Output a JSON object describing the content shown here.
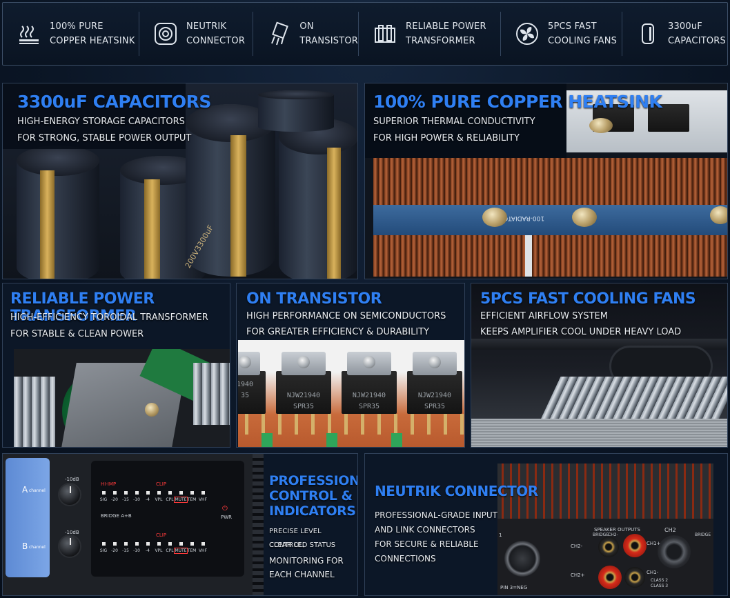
{
  "features": [
    {
      "icon": "heatsink-icon",
      "label": "100% PURE\nCOPPER HEATSINK"
    },
    {
      "icon": "neutrik-connector-icon",
      "label": "NEUTRIK\nCONNECTOR"
    },
    {
      "icon": "transistor-icon",
      "label": "ON\nTRANSISTOR"
    },
    {
      "icon": "transformer-icon",
      "label": "RELIABLE POWER\nTRANSFORMER"
    },
    {
      "icon": "fan-icon",
      "label": "5PCS FAST\nCOOLING FANS"
    },
    {
      "icon": "capacitor-icon",
      "label": "3300uF\nCAPACITORS"
    }
  ],
  "panels": {
    "capacitors": {
      "title": "3300uF CAPACITORS",
      "line1": "HIGH-ENERGY STORAGE CAPACITORS",
      "line2": "FOR STRONG, STABLE POWER OUTPUT"
    },
    "heatsink": {
      "title": "100% PURE COPPER HEATSINK",
      "line1": "SUPERIOR THERMAL CONDUCTIVITY",
      "line2": "FOR HIGH POWER & RELIABILITY"
    },
    "transformer": {
      "title": "RELIABLE POWER TRANSFORMER",
      "line1": "HIGH-EFFICIENCY TOROIDAL TRANSFORMER",
      "line2": "FOR STABLE & CLEAN POWER"
    },
    "transistor": {
      "title": "ON TRANSISTOR",
      "line1": "HIGH PERFORMANCE ON SEMICONDUCTORS",
      "line2": "FOR GREATER EFFICIENCY & DURABILITY"
    },
    "fans": {
      "title": "5PCS FAST COOLING FANS",
      "line1": "EFFICIENT AIRFLOW SYSTEM",
      "line2": "KEEPS AMPLIFIER COOL UNDER HEAVY LOAD"
    },
    "control": {
      "title_line1": "PROFESSIONAL",
      "title_line2": "CONTROL &",
      "title_line3": "INDICATORS",
      "small1": "PRECISE LEVEL CONTROL,",
      "small2": "CLEAR LED STATUS",
      "line1": "MONITORING FOR",
      "line2": "EACH CHANNEL"
    },
    "neutrik": {
      "title": "NEUTRIK CONNECTOR",
      "line1": "PROFESSIONAL-GRADE INPUT",
      "line2": "AND LINK CONNECTORS",
      "line3": "FOR SECURE & RELIABLE",
      "line4": "CONNECTIONS"
    }
  },
  "photo_text": {
    "transistor_model": "NJW21940",
    "transistor_code": "SPR35",
    "heatsink_strip": "100-RADIATO",
    "capacitor_marking": "200V3300uF",
    "front_panel": {
      "channel_a": "A",
      "channel_a_sub": "channel",
      "channel_b": "B",
      "channel_b_sub": "channel",
      "hi_imp": "HI-IMP",
      "clip": "CLIP",
      "led_labels": [
        "SIG",
        "-20",
        "-15",
        "-10",
        "-4",
        "VPL",
        "CPL",
        "MUTE",
        "TEM",
        "VHF"
      ],
      "bridge": "BRIDGE A+B",
      "pwr": "PWR",
      "knob_top": "-10dB",
      "knob_bottom": "-10dB"
    },
    "rear_panel": {
      "speaker_outputs": "SPEAKER OUTPUTS",
      "pin3": "PIN 3=NEG",
      "ch2": "CH2",
      "bridge": "BRIDGE",
      "ch2_minus": "CH2-",
      "ch2_plus": "CH2+",
      "ch1_plus": "CH1+",
      "ch1_minus": "CH1-",
      "class2": "CLASS 2",
      "class3": "CLASS 3",
      "ch1_num": "1"
    }
  },
  "colors": {
    "accent": "#2f7ff2",
    "background": "#0b1626",
    "border": "#2f4058"
  }
}
